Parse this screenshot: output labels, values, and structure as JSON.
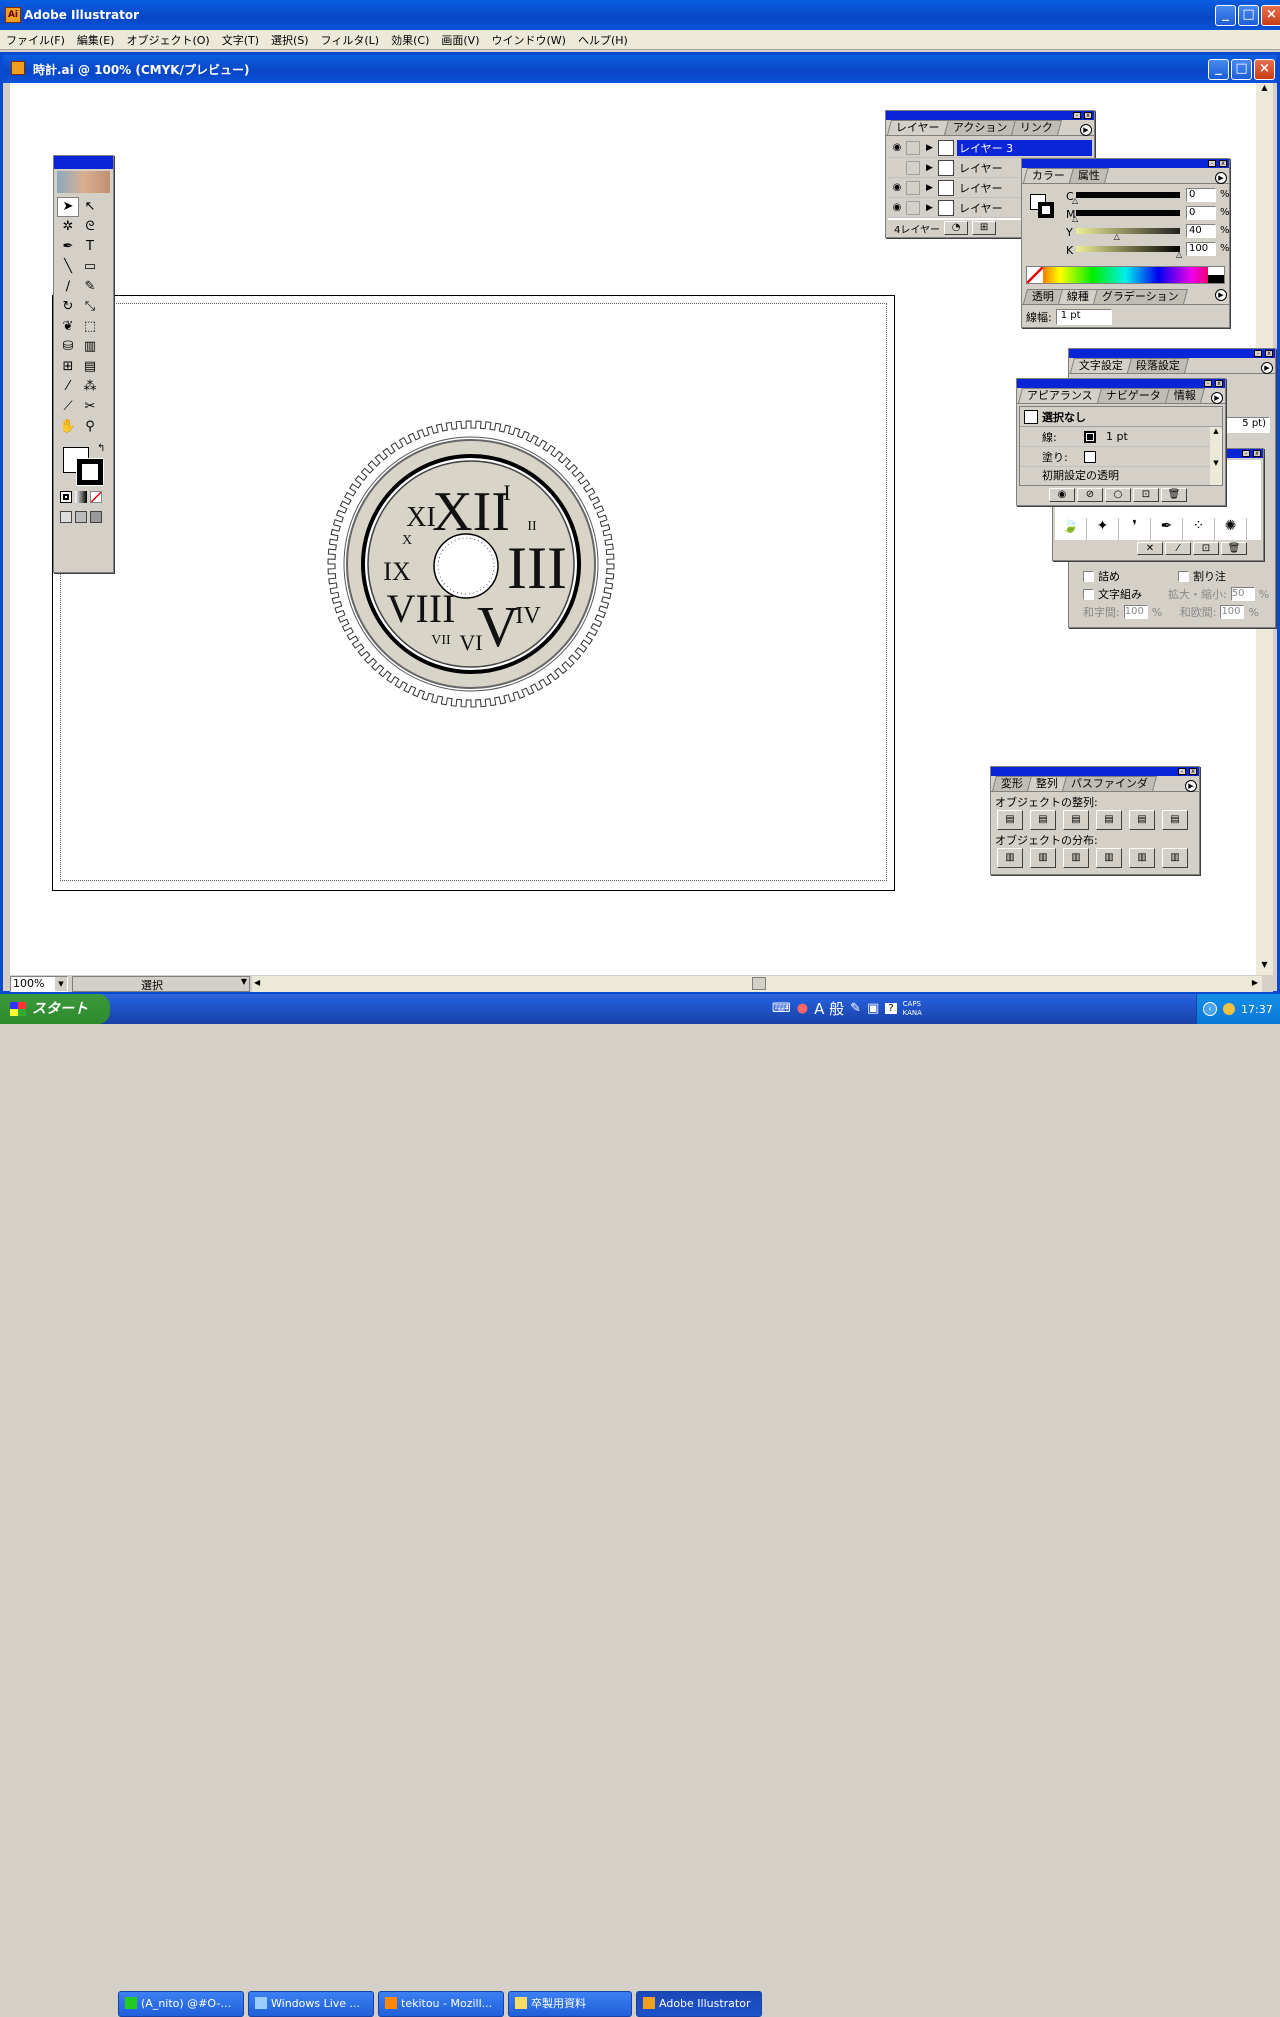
{
  "app": {
    "title": "Adobe Illustrator"
  },
  "menu": [
    "ファイル(F)",
    "編集(E)",
    "オブジェクト(O)",
    "文字(T)",
    "選択(S)",
    "フィルタ(L)",
    "効果(C)",
    "画面(V)",
    "ウインドウ(W)",
    "ヘルプ(H)"
  ],
  "document": {
    "title": "時計.ai @ 100% (CMYK/プレビュー)"
  },
  "clock": {
    "numerals": [
      "XII",
      "I",
      "II",
      "III",
      "IV",
      "V",
      "VI",
      "VII",
      "VIII",
      "IX",
      "X",
      "XI"
    ]
  },
  "layers_panel": {
    "tabs": [
      "レイヤー",
      "アクション",
      "リンク"
    ],
    "layers": [
      {
        "name": "レイヤー 3",
        "visible": true,
        "selected": true
      },
      {
        "name": "レイヤー",
        "visible": false,
        "selected": false
      },
      {
        "name": "レイヤー",
        "visible": true,
        "selected": false
      },
      {
        "name": "レイヤー",
        "visible": true,
        "selected": false
      }
    ],
    "count_label": "4レイヤー"
  },
  "color_panel": {
    "tabs": [
      "カラー",
      "属性"
    ],
    "channels": [
      {
        "label": "C",
        "value": "0"
      },
      {
        "label": "M",
        "value": "0"
      },
      {
        "label": "Y",
        "value": "40"
      },
      {
        "label": "K",
        "value": "100"
      }
    ],
    "percent": "%"
  },
  "stroke_panel": {
    "tabs": [
      "透明",
      "線種",
      "グラデーション"
    ],
    "width_label": "線幅:",
    "width_value": "1 pt"
  },
  "type_panel": {
    "tabs": [
      "文字設定",
      "段落設定"
    ],
    "partial_value": "5 pt)",
    "options": {
      "tsume": "詰め",
      "warichu": "割り注",
      "mojigumi": "文字組み",
      "scale_label": "拡大・縮小:",
      "scale_value": "50",
      "wajikan_label": "和字間:",
      "wajikan_value": "100",
      "waokan_label": "和欧間:",
      "waokan_value": "100",
      "percent": "%"
    }
  },
  "appearance_panel": {
    "tabs": [
      "アピアランス",
      "ナビゲータ",
      "情報"
    ],
    "header": "選択なし",
    "rows": [
      {
        "label": "線:",
        "value": "1 pt"
      },
      {
        "label": "塗り:",
        "value": ""
      }
    ],
    "footer": "初期設定の透明"
  },
  "align_panel": {
    "tabs": [
      "変形",
      "整列",
      "パスファインダ"
    ],
    "align_label": "オブジェクトの整列:",
    "distribute_label": "オブジェクトの分布:"
  },
  "status": {
    "zoom": "100%",
    "mode": "選択"
  },
  "taskbar": {
    "start": "スタート",
    "tasks": [
      "(A_nito) @#O-…",
      "Windows Live ...",
      "tekitou - Mozill...",
      "卒製用資料",
      "Adobe Illustrator"
    ],
    "ime": "A 般",
    "caps": "CAPS",
    "kana": "KANA",
    "clock": "17:37"
  },
  "colors": {
    "xp_blue": "#0a5ee0",
    "clock_face": "#d8d4c8",
    "artboard": "#ffffff"
  }
}
